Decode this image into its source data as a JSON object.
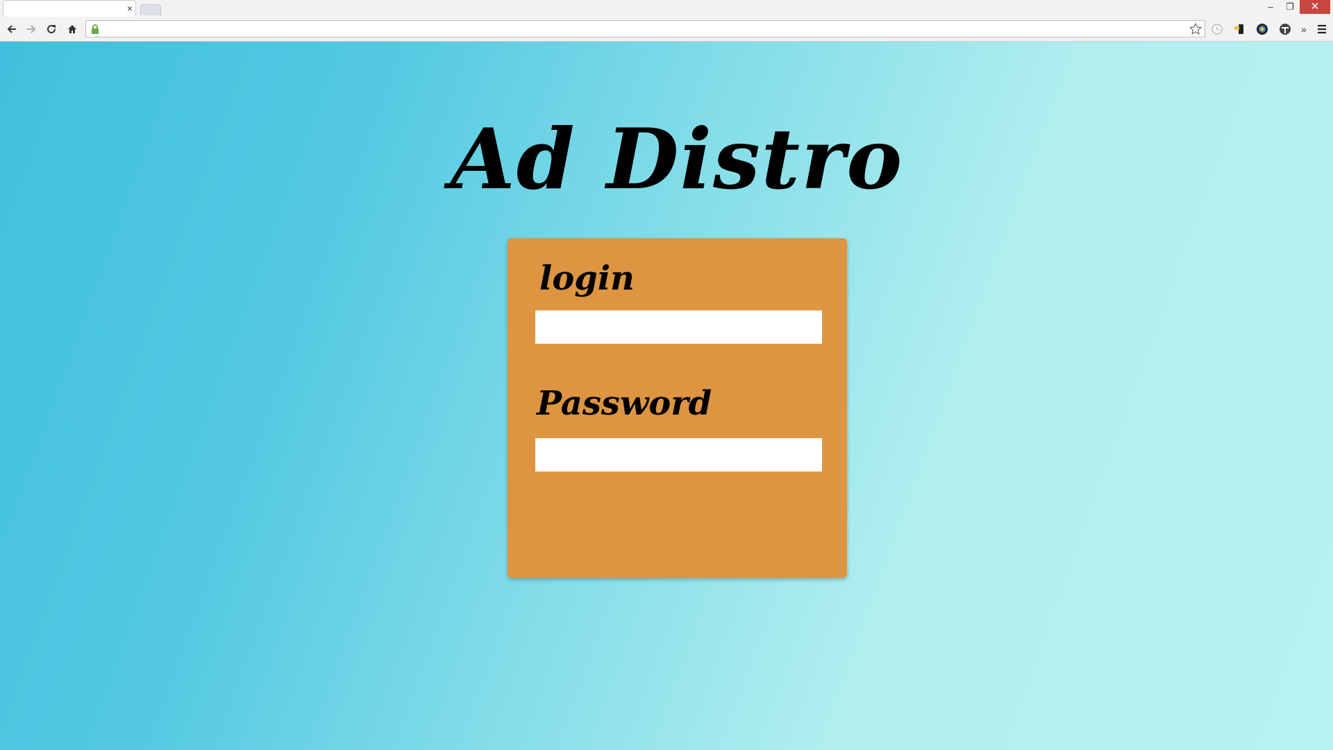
{
  "browser": {
    "tab": {
      "title": "",
      "close_glyph": "×"
    },
    "window_controls": {
      "minimize": "–",
      "restore": "❐",
      "close": "✕"
    },
    "address_bar": {
      "value": ""
    },
    "icons": [
      "back-arrow-icon",
      "forward-arrow-icon",
      "reload-icon",
      "home-icon",
      "lock-icon",
      "star-icon",
      "extension-icons",
      "menu-icon"
    ],
    "overflow_chevron": "»"
  },
  "page": {
    "title": "Ad Distro",
    "background_colors": [
      "#40c0de",
      "#b8f2f2"
    ],
    "card_color": "#dd9541",
    "login": {
      "label": "login",
      "value": ""
    },
    "password": {
      "label": "Password",
      "value": ""
    }
  }
}
